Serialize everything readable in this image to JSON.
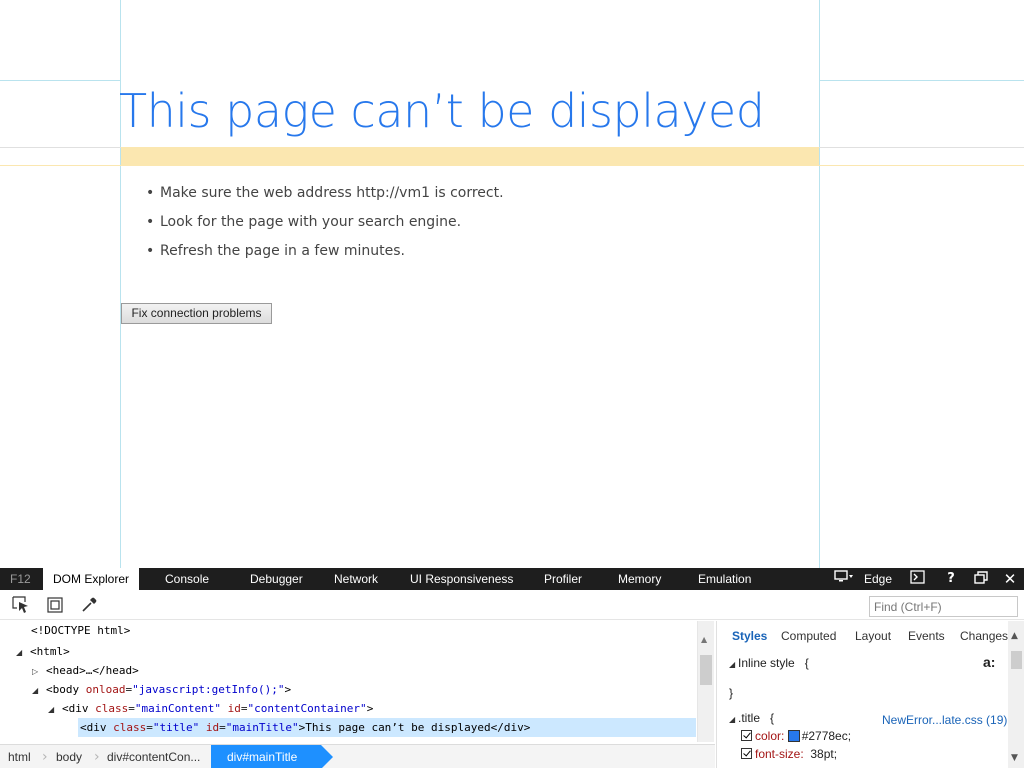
{
  "page": {
    "title": "This page can’t be displayed",
    "tips": [
      "Make sure the web address http://vm1 is correct.",
      "Look for the page with your search engine.",
      "Refresh the page in a few minutes."
    ],
    "fix_button": "Fix connection problems"
  },
  "devtools": {
    "tabs": {
      "f12": "F12",
      "dom_explorer": "DOM Explorer",
      "console": "Console",
      "debugger": "Debugger",
      "network": "Network",
      "ui_responsiveness": "UI Responsiveness",
      "profiler": "Profiler",
      "memory": "Memory",
      "emulation": "Emulation"
    },
    "mode": "Edge",
    "find_placeholder": "Find (Ctrl+F)",
    "dom": {
      "doctype": "<!DOCTYPE html>",
      "html_open": "<html>",
      "head": "<head>…</head>",
      "body_tag": "<body",
      "body_attr": "onload",
      "body_val": "\"javascript:getInfo();\"",
      "body_close": ">",
      "div_tag": "<div",
      "div_class_attr": "class",
      "div_class_val": "\"mainContent\"",
      "div_id_attr": "id",
      "div_id_val": "\"contentContainer\"",
      "div_close": ">",
      "sel_tag": "<div",
      "sel_class_attr": "class",
      "sel_class_val": "\"title\"",
      "sel_id_attr": "id",
      "sel_id_val": "\"mainTitle\"",
      "sel_text": ">This page can’t be displayed</div>"
    },
    "breadcrumbs": [
      "html",
      "body",
      "div#contentCon...",
      "div#mainTitle"
    ],
    "styles_tabs": [
      "Styles",
      "Computed",
      "Layout",
      "Events",
      "Changes"
    ],
    "styles": {
      "inline_label": "Inline style",
      "open_brace": "{",
      "close_brace": "}",
      "font_toggle": "a:",
      "rule_selector": ".title",
      "source": "NewError...late.css (19)",
      "props": [
        {
          "name": "color:",
          "value": "#2778ec;",
          "swatch": "#2778ec"
        },
        {
          "name": "font-size:",
          "value": "38pt;"
        }
      ]
    }
  }
}
